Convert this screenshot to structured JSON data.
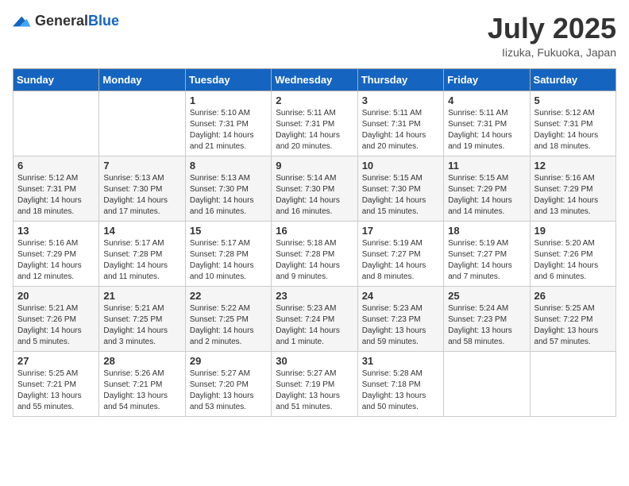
{
  "header": {
    "logo_general": "General",
    "logo_blue": "Blue",
    "month_title": "July 2025",
    "location": "Iizuka, Fukuoka, Japan"
  },
  "days_of_week": [
    "Sunday",
    "Monday",
    "Tuesday",
    "Wednesday",
    "Thursday",
    "Friday",
    "Saturday"
  ],
  "weeks": [
    [
      {
        "day": "",
        "sunrise": "",
        "sunset": "",
        "daylight": ""
      },
      {
        "day": "",
        "sunrise": "",
        "sunset": "",
        "daylight": ""
      },
      {
        "day": "1",
        "sunrise": "Sunrise: 5:10 AM",
        "sunset": "Sunset: 7:31 PM",
        "daylight": "Daylight: 14 hours and 21 minutes."
      },
      {
        "day": "2",
        "sunrise": "Sunrise: 5:11 AM",
        "sunset": "Sunset: 7:31 PM",
        "daylight": "Daylight: 14 hours and 20 minutes."
      },
      {
        "day": "3",
        "sunrise": "Sunrise: 5:11 AM",
        "sunset": "Sunset: 7:31 PM",
        "daylight": "Daylight: 14 hours and 20 minutes."
      },
      {
        "day": "4",
        "sunrise": "Sunrise: 5:11 AM",
        "sunset": "Sunset: 7:31 PM",
        "daylight": "Daylight: 14 hours and 19 minutes."
      },
      {
        "day": "5",
        "sunrise": "Sunrise: 5:12 AM",
        "sunset": "Sunset: 7:31 PM",
        "daylight": "Daylight: 14 hours and 18 minutes."
      }
    ],
    [
      {
        "day": "6",
        "sunrise": "Sunrise: 5:12 AM",
        "sunset": "Sunset: 7:31 PM",
        "daylight": "Daylight: 14 hours and 18 minutes."
      },
      {
        "day": "7",
        "sunrise": "Sunrise: 5:13 AM",
        "sunset": "Sunset: 7:30 PM",
        "daylight": "Daylight: 14 hours and 17 minutes."
      },
      {
        "day": "8",
        "sunrise": "Sunrise: 5:13 AM",
        "sunset": "Sunset: 7:30 PM",
        "daylight": "Daylight: 14 hours and 16 minutes."
      },
      {
        "day": "9",
        "sunrise": "Sunrise: 5:14 AM",
        "sunset": "Sunset: 7:30 PM",
        "daylight": "Daylight: 14 hours and 16 minutes."
      },
      {
        "day": "10",
        "sunrise": "Sunrise: 5:15 AM",
        "sunset": "Sunset: 7:30 PM",
        "daylight": "Daylight: 14 hours and 15 minutes."
      },
      {
        "day": "11",
        "sunrise": "Sunrise: 5:15 AM",
        "sunset": "Sunset: 7:29 PM",
        "daylight": "Daylight: 14 hours and 14 minutes."
      },
      {
        "day": "12",
        "sunrise": "Sunrise: 5:16 AM",
        "sunset": "Sunset: 7:29 PM",
        "daylight": "Daylight: 14 hours and 13 minutes."
      }
    ],
    [
      {
        "day": "13",
        "sunrise": "Sunrise: 5:16 AM",
        "sunset": "Sunset: 7:29 PM",
        "daylight": "Daylight: 14 hours and 12 minutes."
      },
      {
        "day": "14",
        "sunrise": "Sunrise: 5:17 AM",
        "sunset": "Sunset: 7:28 PM",
        "daylight": "Daylight: 14 hours and 11 minutes."
      },
      {
        "day": "15",
        "sunrise": "Sunrise: 5:17 AM",
        "sunset": "Sunset: 7:28 PM",
        "daylight": "Daylight: 14 hours and 10 minutes."
      },
      {
        "day": "16",
        "sunrise": "Sunrise: 5:18 AM",
        "sunset": "Sunset: 7:28 PM",
        "daylight": "Daylight: 14 hours and 9 minutes."
      },
      {
        "day": "17",
        "sunrise": "Sunrise: 5:19 AM",
        "sunset": "Sunset: 7:27 PM",
        "daylight": "Daylight: 14 hours and 8 minutes."
      },
      {
        "day": "18",
        "sunrise": "Sunrise: 5:19 AM",
        "sunset": "Sunset: 7:27 PM",
        "daylight": "Daylight: 14 hours and 7 minutes."
      },
      {
        "day": "19",
        "sunrise": "Sunrise: 5:20 AM",
        "sunset": "Sunset: 7:26 PM",
        "daylight": "Daylight: 14 hours and 6 minutes."
      }
    ],
    [
      {
        "day": "20",
        "sunrise": "Sunrise: 5:21 AM",
        "sunset": "Sunset: 7:26 PM",
        "daylight": "Daylight: 14 hours and 5 minutes."
      },
      {
        "day": "21",
        "sunrise": "Sunrise: 5:21 AM",
        "sunset": "Sunset: 7:25 PM",
        "daylight": "Daylight: 14 hours and 3 minutes."
      },
      {
        "day": "22",
        "sunrise": "Sunrise: 5:22 AM",
        "sunset": "Sunset: 7:25 PM",
        "daylight": "Daylight: 14 hours and 2 minutes."
      },
      {
        "day": "23",
        "sunrise": "Sunrise: 5:23 AM",
        "sunset": "Sunset: 7:24 PM",
        "daylight": "Daylight: 14 hours and 1 minute."
      },
      {
        "day": "24",
        "sunrise": "Sunrise: 5:23 AM",
        "sunset": "Sunset: 7:23 PM",
        "daylight": "Daylight: 13 hours and 59 minutes."
      },
      {
        "day": "25",
        "sunrise": "Sunrise: 5:24 AM",
        "sunset": "Sunset: 7:23 PM",
        "daylight": "Daylight: 13 hours and 58 minutes."
      },
      {
        "day": "26",
        "sunrise": "Sunrise: 5:25 AM",
        "sunset": "Sunset: 7:22 PM",
        "daylight": "Daylight: 13 hours and 57 minutes."
      }
    ],
    [
      {
        "day": "27",
        "sunrise": "Sunrise: 5:25 AM",
        "sunset": "Sunset: 7:21 PM",
        "daylight": "Daylight: 13 hours and 55 minutes."
      },
      {
        "day": "28",
        "sunrise": "Sunrise: 5:26 AM",
        "sunset": "Sunset: 7:21 PM",
        "daylight": "Daylight: 13 hours and 54 minutes."
      },
      {
        "day": "29",
        "sunrise": "Sunrise: 5:27 AM",
        "sunset": "Sunset: 7:20 PM",
        "daylight": "Daylight: 13 hours and 53 minutes."
      },
      {
        "day": "30",
        "sunrise": "Sunrise: 5:27 AM",
        "sunset": "Sunset: 7:19 PM",
        "daylight": "Daylight: 13 hours and 51 minutes."
      },
      {
        "day": "31",
        "sunrise": "Sunrise: 5:28 AM",
        "sunset": "Sunset: 7:18 PM",
        "daylight": "Daylight: 13 hours and 50 minutes."
      },
      {
        "day": "",
        "sunrise": "",
        "sunset": "",
        "daylight": ""
      },
      {
        "day": "",
        "sunrise": "",
        "sunset": "",
        "daylight": ""
      }
    ]
  ]
}
